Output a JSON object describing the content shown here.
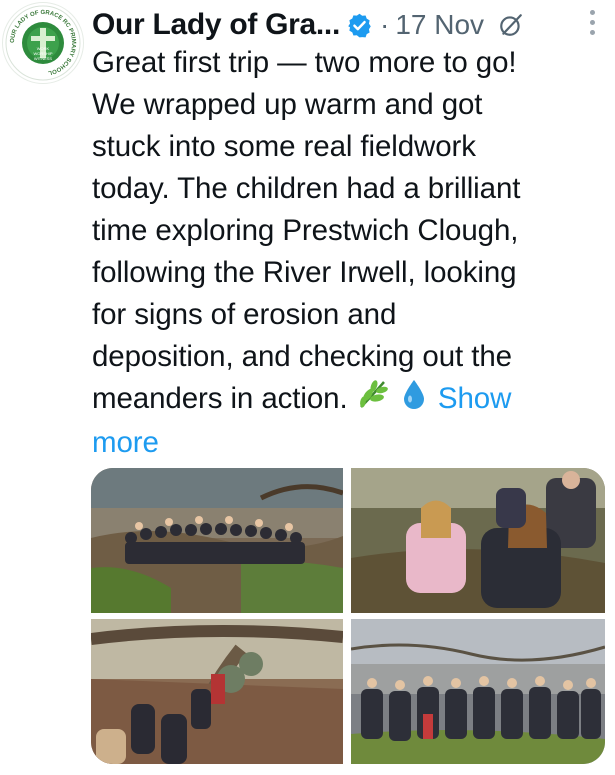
{
  "tweet": {
    "author_name": "Our Lady of Gra...",
    "separator": "·",
    "date": "17 Nov",
    "text_lines": [
      "Great first trip — two more to go!",
      "We wrapped up warm and got",
      "stuck into some real fieldwork",
      "today. The children had a brilliant",
      "time exploring Prestwich Clough,",
      "following the River Irwell, looking",
      "for signs of erosion and",
      "deposition, and checking out the",
      "meanders in action."
    ],
    "emojis": [
      "🌿",
      "💧"
    ],
    "show_more_a": "Show",
    "show_more_b": "more"
  },
  "avatar": {
    "ring_text": "OUR LADY OF GRACE RC PRIMARY SCHOOL",
    "center_text": [
      "WORK",
      "WORSHIP",
      "WITNESS"
    ]
  },
  "icons": {
    "verified": "verified-badge-icon",
    "grok": "grok-icon",
    "more": "more-options-icon"
  },
  "colors": {
    "verified": "#1d9bf0",
    "link": "#1d9bf0",
    "secondary_text": "#536471",
    "badge_green": "#2e8b3d"
  }
}
